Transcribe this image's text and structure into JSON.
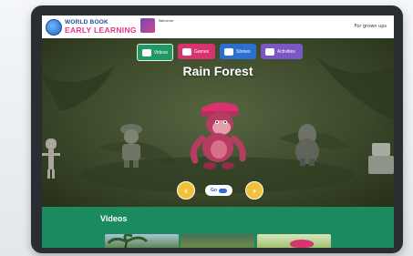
{
  "header": {
    "logo_line1": "WORLD BOOK",
    "logo_line2": "EARLY LEARNING",
    "welcome": "Welcome",
    "grownups_link": "For grown ups"
  },
  "tabs": [
    {
      "label": "Videos",
      "icon": "video-icon",
      "color": "#1f9a63"
    },
    {
      "label": "Games",
      "icon": "gamepad-icon",
      "color": "#d8336f"
    },
    {
      "label": "Stories",
      "icon": "book-icon",
      "color": "#2b6fd0"
    },
    {
      "label": "Activities",
      "icon": "palette-icon",
      "color": "#7b57c4"
    }
  ],
  "scene": {
    "title": "Rain Forest",
    "go_label": "Go"
  },
  "videos": {
    "title": "Videos",
    "thumbnails": [
      "palm-trees-thumbnail",
      "jungle-pond-thumbnail",
      "bird-thumbnail"
    ]
  }
}
